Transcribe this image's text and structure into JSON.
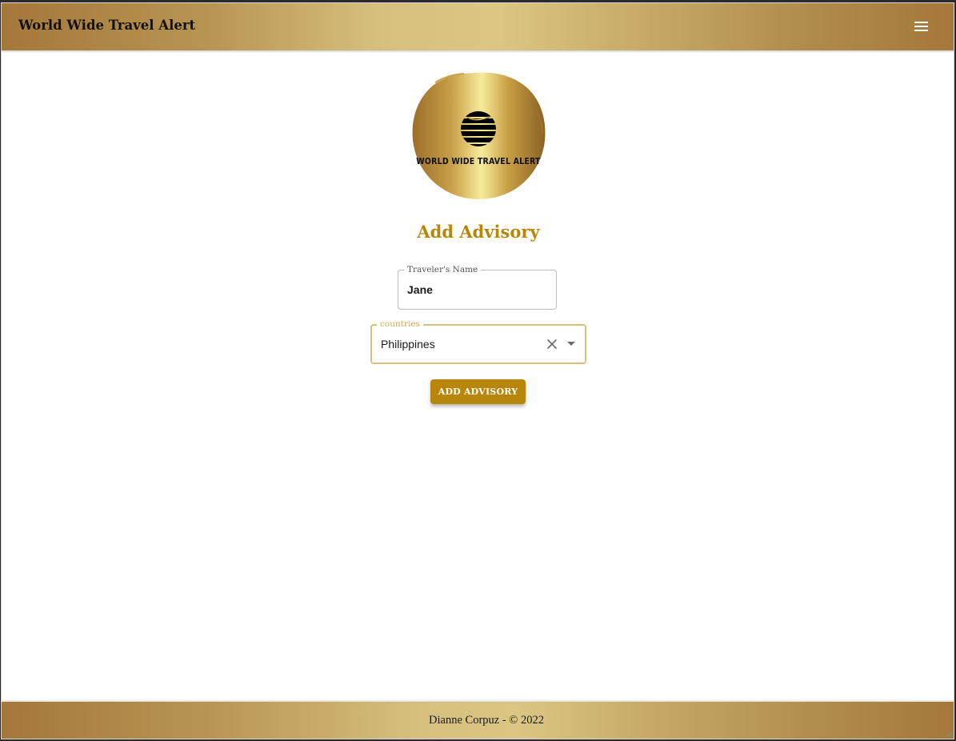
{
  "appbar": {
    "title": "World Wide Travel Alert",
    "menu_icon": "hamburger-menu-icon"
  },
  "logo": {
    "text": "WORLD WIDE TRAVEL ALERT",
    "icon": "striped-globe-icon"
  },
  "form": {
    "title": "Add Advisory",
    "name_field": {
      "label": "Traveler's Name",
      "value": "Jane"
    },
    "country_field": {
      "label": "countries",
      "value": "Philippines",
      "clear_icon": "close-icon",
      "dropdown_icon": "arrow-drop-down-icon"
    },
    "submit_label": "ADD ADVISORY"
  },
  "footer": {
    "text": "Dianne Corpuz - © 2022"
  },
  "colors": {
    "accent": "#b8860b",
    "gold_light": "#dcc683",
    "gold_dark": "#a47838",
    "focus_border": "#d8c27a"
  }
}
